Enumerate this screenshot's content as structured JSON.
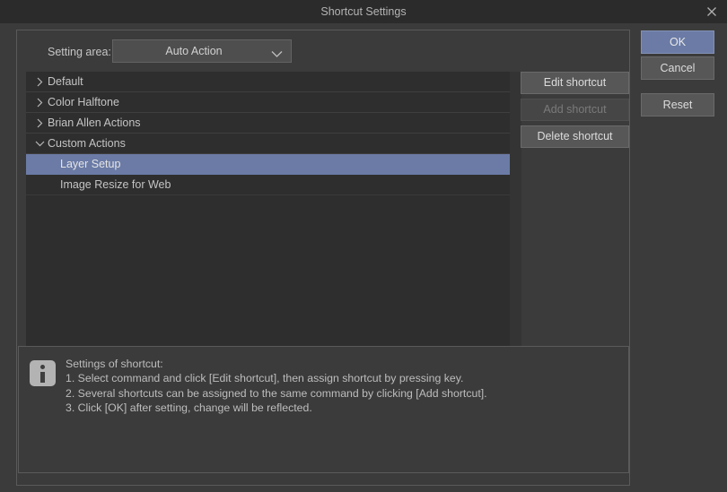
{
  "window": {
    "title": "Shortcut Settings",
    "close_icon": "close-icon"
  },
  "setting_area": {
    "label": "Setting area:",
    "selected": "Auto Action",
    "chevron_icon": "chevron-down-icon"
  },
  "tree": [
    {
      "label": "Default",
      "level": 0,
      "expanded": false,
      "selected": false,
      "twisty": "chevron-right-icon"
    },
    {
      "label": "Color Halftone",
      "level": 0,
      "expanded": false,
      "selected": false,
      "twisty": "chevron-right-icon"
    },
    {
      "label": "Brian Allen Actions",
      "level": 0,
      "expanded": false,
      "selected": false,
      "twisty": "chevron-right-icon"
    },
    {
      "label": "Custom Actions",
      "level": 0,
      "expanded": true,
      "selected": false,
      "twisty": "chevron-down-icon"
    },
    {
      "label": "Layer Setup",
      "level": 1,
      "expanded": false,
      "selected": true,
      "twisty": ""
    },
    {
      "label": "Image Resize for Web",
      "level": 1,
      "expanded": false,
      "selected": false,
      "twisty": ""
    }
  ],
  "action_buttons": {
    "edit": "Edit shortcut",
    "add": "Add shortcut",
    "delete": "Delete shortcut",
    "add_disabled": true
  },
  "side_buttons": {
    "ok": "OK",
    "cancel": "Cancel",
    "reset": "Reset"
  },
  "info": {
    "icon": "info-icon",
    "text": "Settings of shortcut:\n1. Select command and click [Edit shortcut], then assign shortcut by pressing key.\n2. Several shortcuts can be assigned to the same command by clicking [Add shortcut].\n3. Click [OK] after setting, change will be reflected."
  },
  "colors": {
    "accent": "#6b7ba6",
    "dialog_bg": "#3b3b3b",
    "titlebar_bg": "#2b2b2b",
    "list_bg": "#2e2e2e"
  }
}
